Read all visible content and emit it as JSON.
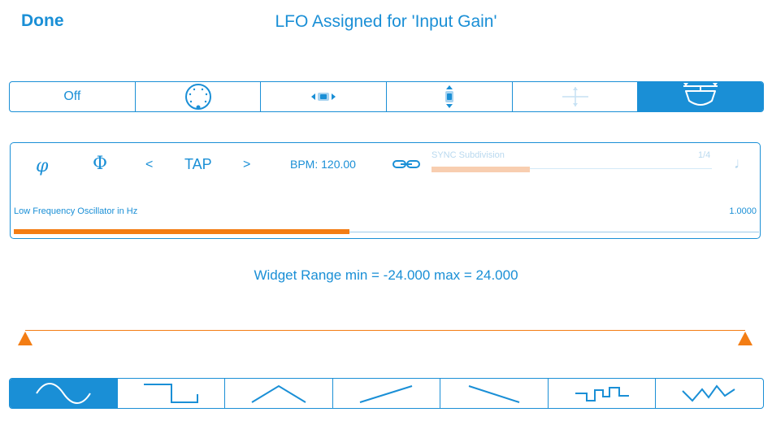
{
  "header": {
    "done_label": "Done",
    "title": "LFO Assigned for 'Input Gain'"
  },
  "modes": {
    "items": [
      {
        "label": "Off",
        "icon": "text"
      },
      {
        "label": "",
        "icon": "knob-icon"
      },
      {
        "label": "",
        "icon": "horizontal-slider-icon"
      },
      {
        "label": "",
        "icon": "vertical-slider-icon"
      },
      {
        "label": "",
        "icon": "xy-pad-icon"
      },
      {
        "label": "",
        "icon": "range-gauge-icon"
      }
    ],
    "selected_index": 5
  },
  "tempo": {
    "phase_lower_symbol": "φ",
    "phase_upper_symbol": "Φ",
    "prev_label": "<",
    "tap_label": "TAP",
    "next_label": ">",
    "bpm_text": "BPM: 120.00",
    "link_icon": "link-icon",
    "sync_label": "SYNC Subdivision",
    "sync_value": "1/4",
    "sync_level": 0.35,
    "note_symbol": "♩"
  },
  "frequency": {
    "label": "Low Frequency Oscillator in Hz",
    "value": "1.0000",
    "level": 0.45
  },
  "range": {
    "text": "Widget Range min = -24.000 max = 24.000"
  },
  "waveforms": {
    "items": [
      "sine",
      "square",
      "triangle",
      "ramp-up",
      "ramp-down",
      "random-step",
      "random-smooth"
    ],
    "selected_index": 0
  },
  "colors": {
    "accent": "#1a8fd6",
    "orange": "#f37d14",
    "muted": "#b9d9ef",
    "sync_fill": "#f8ceb0"
  }
}
